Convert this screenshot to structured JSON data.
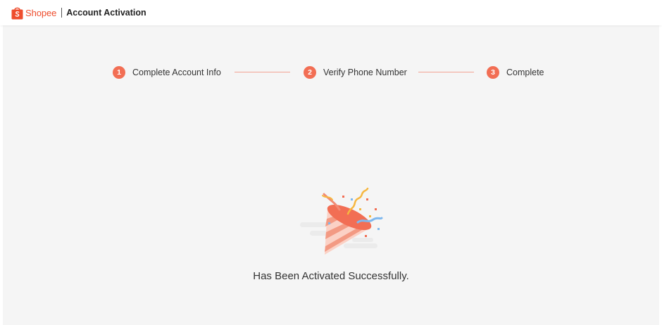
{
  "header": {
    "brand": "Shopee",
    "title": "Account Activation"
  },
  "steps": [
    {
      "number": "1",
      "label": "Complete Account Info"
    },
    {
      "number": "2",
      "label": "Verify Phone Number"
    },
    {
      "number": "3",
      "label": "Complete"
    }
  ],
  "status": {
    "message": "Has Been Activated Successfully."
  },
  "colors": {
    "brand": "#ee4d2d",
    "step_active": "#f26e54",
    "background": "#f5f5f5"
  },
  "icons": {
    "logo": "shopee-bag-icon",
    "illustration": "party-popper-icon"
  }
}
